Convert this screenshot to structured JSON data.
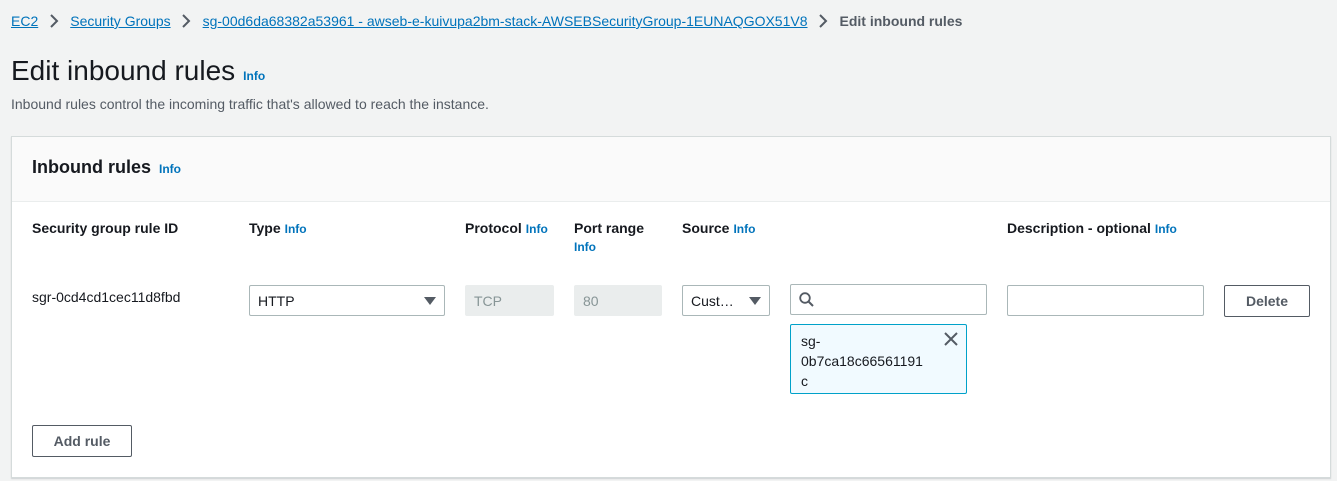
{
  "breadcrumb": {
    "items": [
      "EC2",
      "Security Groups",
      "sg-00d6da68382a53961 - awseb-e-kuivupa2bm-stack-AWSEBSecurityGroup-1EUNAQGOX51V8"
    ],
    "current": "Edit inbound rules"
  },
  "page": {
    "title": "Edit inbound rules",
    "title_info": "Info",
    "description": "Inbound rules control the incoming traffic that's allowed to reach the instance."
  },
  "panel": {
    "title": "Inbound rules",
    "title_info": "Info",
    "columns": {
      "rule_id": "Security group rule ID",
      "type": "Type",
      "type_info": "Info",
      "protocol": "Protocol",
      "protocol_info": "Info",
      "port_range": "Port range",
      "port_range_info": "Info",
      "source": "Source",
      "source_info": "Info",
      "description": "Description - optional",
      "description_info": "Info"
    },
    "rule": {
      "rule_id": "sgr-0cd4cd1cec11d8fbd",
      "type": "HTTP",
      "protocol": "TCP",
      "port_range": "80",
      "source_type": "Cust…",
      "source_search_value": "",
      "source_token_lines": [
        "sg-",
        "0b7ca18c66561191",
        "c"
      ],
      "description_value": "",
      "delete_label": "Delete"
    },
    "add_rule_label": "Add rule"
  },
  "colors": {
    "link": "#0073bb",
    "background": "#f2f3f3",
    "token_border": "#00a1c9",
    "token_background": "#f1faff"
  }
}
